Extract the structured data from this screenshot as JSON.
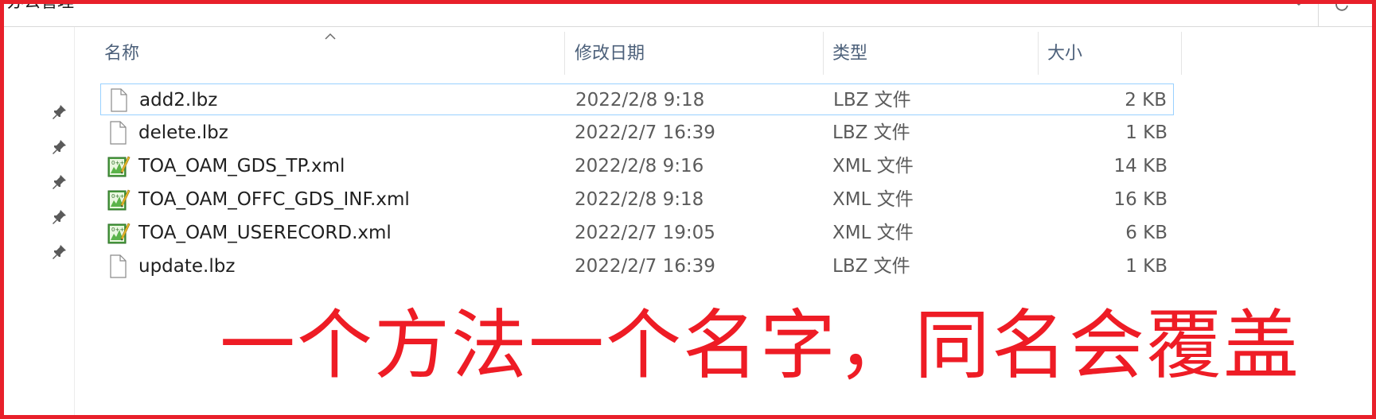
{
  "address_bar": {
    "path": "办公管理",
    "dropdown_icon": "chevron-down-icon",
    "refresh_icon": "refresh-icon"
  },
  "nav_pane": {
    "pins": [
      "pin-icon",
      "pin-icon",
      "pin-icon",
      "pin-icon",
      "pin-icon"
    ]
  },
  "columns": {
    "name": "名称",
    "date": "修改日期",
    "type": "类型",
    "size": "大小",
    "sort_icon": "sort-ascending-icon"
  },
  "files": [
    {
      "name": "add2.lbz",
      "date": "2022/2/8 9:18",
      "type": "LBZ 文件",
      "size": "2 KB",
      "icon": "blank-file-icon",
      "selected": true
    },
    {
      "name": "delete.lbz",
      "date": "2022/2/7 16:39",
      "type": "LBZ 文件",
      "size": "1 KB",
      "icon": "blank-file-icon",
      "selected": false
    },
    {
      "name": "TOA_OAM_GDS_TP.xml",
      "date": "2022/2/8 9:16",
      "type": "XML 文件",
      "size": "14 KB",
      "icon": "xml-file-icon",
      "selected": false
    },
    {
      "name": "TOA_OAM_OFFC_GDS_INF.xml",
      "date": "2022/2/8 9:18",
      "type": "XML 文件",
      "size": "16 KB",
      "icon": "xml-file-icon",
      "selected": false
    },
    {
      "name": "TOA_OAM_USERECORD.xml",
      "date": "2022/2/7 19:05",
      "type": "XML 文件",
      "size": "6 KB",
      "icon": "xml-file-icon",
      "selected": false
    },
    {
      "name": "update.lbz",
      "date": "2022/2/7 16:39",
      "type": "LBZ 文件",
      "size": "1 KB",
      "icon": "blank-file-icon",
      "selected": false
    }
  ],
  "annotation": {
    "text": "一个方法一个名字，同名会覆盖",
    "color": "#ee1c25"
  },
  "colors": {
    "frame": "#e8202a",
    "header_text": "#4c607a",
    "selection_border": "#99d1ff"
  }
}
